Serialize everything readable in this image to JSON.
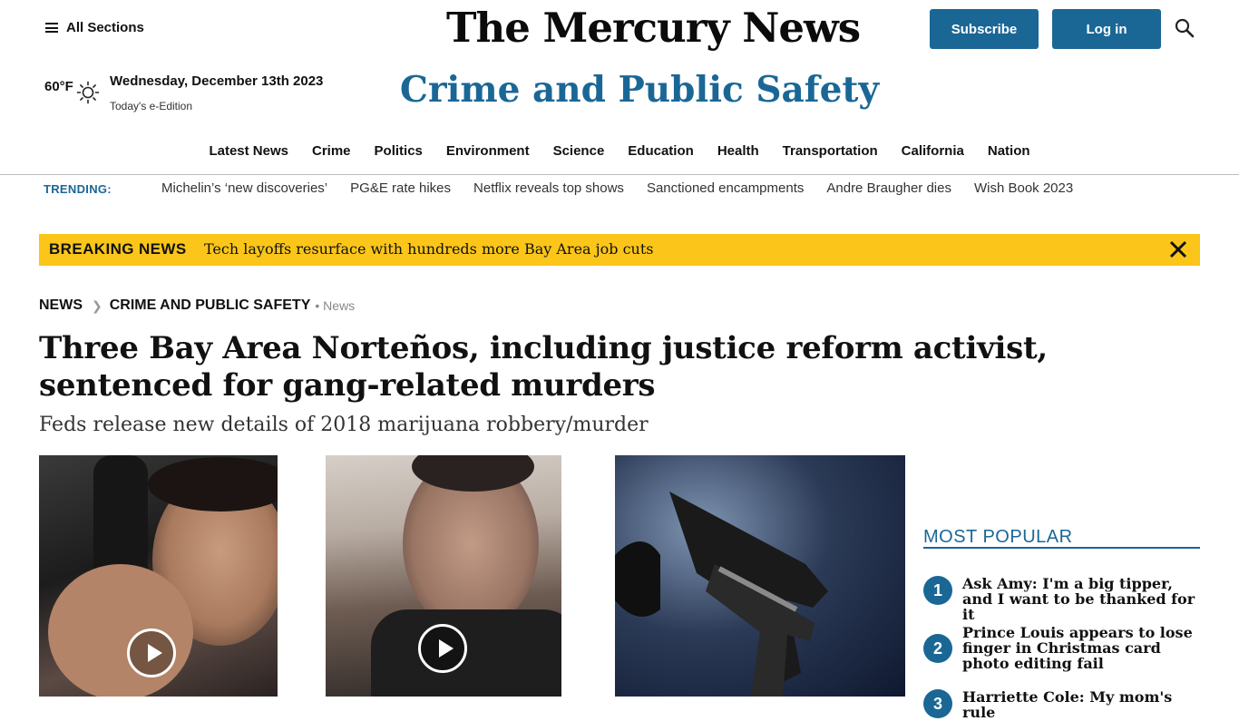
{
  "header": {
    "all_sections": "All Sections",
    "masthead": "The Mercury News",
    "subscribe": "Subscribe",
    "login": "Log in",
    "temperature": "60°F",
    "date": "Wednesday, December 13th 2023",
    "edition": "Today's e-Edition",
    "section_title": "Crime and Public Safety",
    "accent_color": "#1a6796"
  },
  "nav": [
    "Latest News",
    "Crime",
    "Politics",
    "Environment",
    "Science",
    "Education",
    "Health",
    "Transportation",
    "California",
    "Nation"
  ],
  "trending": {
    "label": "TRENDING:",
    "items": [
      "Michelin’s ‘new discoveries’",
      "PG&E rate hikes",
      "Netflix reveals top shows",
      "Sanctioned encampments",
      "Andre Braugher dies",
      "Wish Book 2023"
    ]
  },
  "breaking": {
    "label": "BREAKING NEWS",
    "headline": "Tech layoffs resurface with hundreds more Bay Area job cuts",
    "color": "#fbc619"
  },
  "breadcrumb": {
    "items": [
      "News",
      "Crime and Public Safety"
    ],
    "tag": "• News"
  },
  "article": {
    "headline": "Three Bay Area Norteños, including justice reform activist, sentenced for gang-related murders",
    "dek": "Feds release new details of 2018 marijuana robbery/murder"
  },
  "most_popular": {
    "title": "MOST POPULAR",
    "items": [
      {
        "num": "1",
        "text": "Ask Amy: I'm a big tipper, and I want to be thanked for it"
      },
      {
        "num": "2",
        "text": "Prince Louis appears to lose finger in Christmas card photo editing fail"
      },
      {
        "num": "3",
        "text": "Harriette Cole: My mom's rule"
      }
    ]
  }
}
